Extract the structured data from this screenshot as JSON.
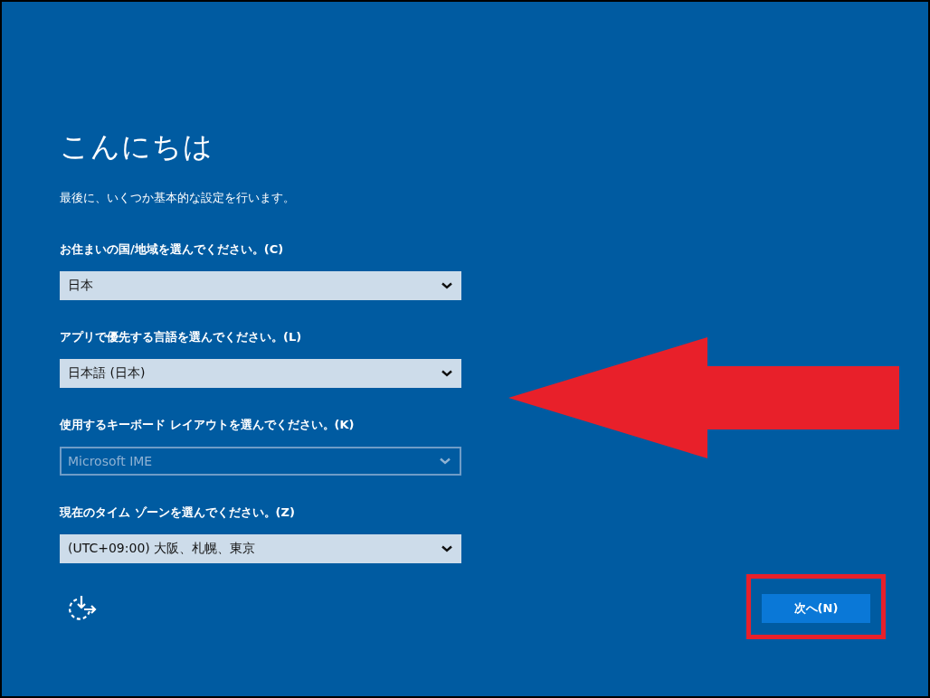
{
  "title": "こんにちは",
  "subtitle": "最後に、いくつか基本的な設定を行います。",
  "fields": [
    {
      "label": "お住まいの国/地域を選んでください。(C)",
      "value": "日本",
      "disabled": false
    },
    {
      "label": "アプリで優先する言語を選んでください。(L)",
      "value": "日本語 (日本)",
      "disabled": false
    },
    {
      "label": "使用するキーボード レイアウトを選んでください。(K)",
      "value": "Microsoft IME",
      "disabled": true
    },
    {
      "label": "現在のタイム ゾーンを選んでください。(Z)",
      "value": "(UTC+09:00) 大阪、札幌、東京",
      "disabled": false
    }
  ],
  "next_button": {
    "label": "次へ(N)"
  }
}
